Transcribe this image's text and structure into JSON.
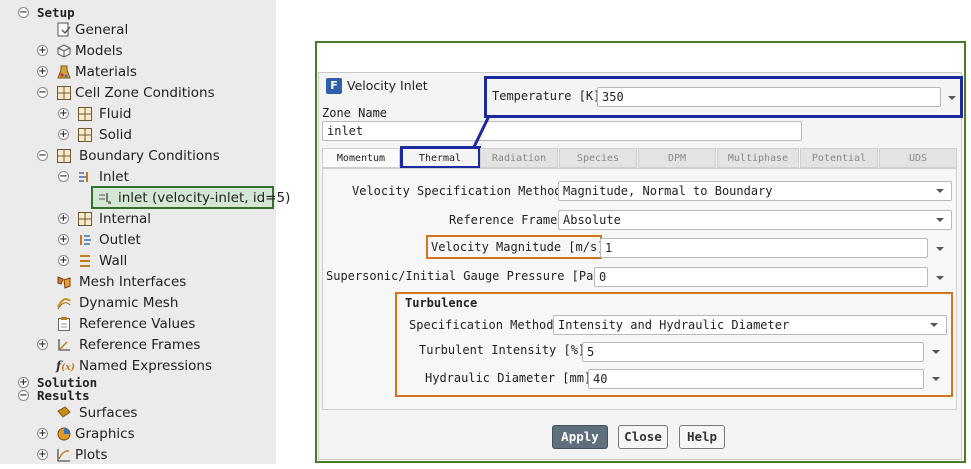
{
  "tree": {
    "setup": "Setup",
    "general": "General",
    "models": "Models",
    "materials": "Materials",
    "cell_zone_conditions": "Cell Zone Conditions",
    "fluid": "Fluid",
    "solid": "Solid",
    "boundary_conditions": "Boundary Conditions",
    "inlet_group": "Inlet",
    "inlet_item": "inlet (velocity-inlet, id=5)",
    "internal": "Internal",
    "outlet": "Outlet",
    "wall": "Wall",
    "mesh_interfaces": "Mesh Interfaces",
    "dynamic_mesh": "Dynamic Mesh",
    "reference_values": "Reference Values",
    "reference_frames": "Reference Frames",
    "named_expressions": "Named Expressions",
    "solution": "Solution",
    "results": "Results",
    "surfaces": "Surfaces",
    "graphics": "Graphics",
    "plots": "Plots"
  },
  "dialog": {
    "title": "Velocity Inlet",
    "zone_name_label": "Zone Name",
    "zone_name_value": "inlet",
    "temperature_label": "Temperature [K]",
    "temperature_value": "350",
    "tabs": [
      "Momentum",
      "Thermal",
      "Radiation",
      "Species",
      "DPM",
      "Multiphase",
      "Potential",
      "UDS"
    ],
    "velocity_spec_label": "Velocity Specification Method",
    "velocity_spec_value": "Magnitude, Normal to Boundary",
    "reference_frame_label": "Reference Frame",
    "reference_frame_value": "Absolute",
    "velocity_magnitude_label": "Velocity Magnitude [m/s]",
    "velocity_magnitude_value": "1",
    "pressure_label": "Supersonic/Initial Gauge Pressure [Pa]",
    "pressure_value": "0",
    "turbulence_heading": "Turbulence",
    "spec_method_label": "Specification Method",
    "spec_method_value": "Intensity and Hydraulic Diameter",
    "turb_intensity_label": "Turbulent Intensity [%]",
    "turb_intensity_value": "5",
    "hydraulic_diameter_label": "Hydraulic Diameter [mm]",
    "hydraulic_diameter_value": "40",
    "apply": "Apply",
    "close": "Close",
    "help": "Help"
  },
  "colors": {
    "selection_border": "#35702f",
    "annotation_blue": "#1d2a9c",
    "annotation_orange": "#d2761b",
    "frame_green": "#4b7b2a"
  }
}
